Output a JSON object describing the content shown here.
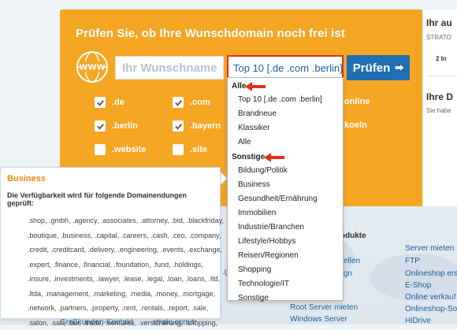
{
  "headline": "Prüfen Sie, ob Ihre Wunschdomain noch frei ist",
  "search": {
    "placeholder": "Ihr Wunschname",
    "value": ""
  },
  "tld_select": {
    "selected": "Top 10 [.de .com .berlin]"
  },
  "check_button": {
    "label": "Prüfen",
    "icon": "arrow-right-icon"
  },
  "checkboxes": [
    {
      "label": ".de",
      "checked": true
    },
    {
      "label": ".com",
      "checked": true
    },
    {
      "label": ".berlin",
      "checked": true
    },
    {
      "label": ".bayern",
      "checked": true
    },
    {
      "label": ".website",
      "checked": false
    },
    {
      "label": ".site",
      "checked": false
    }
  ],
  "hidden_labels": [
    ".online",
    ".koeln"
  ],
  "dropdown": {
    "groups": [
      {
        "label": "Alle",
        "items": [
          "Top 10 [.de .com .berlin]",
          "Brandneue",
          "Klassiker",
          "Alle"
        ]
      },
      {
        "label": "Sonstige",
        "items": [
          "Bildung/Politik",
          "Business",
          "Gesundheit/Ernährung",
          "Immobilien",
          "Industrie/Branchen",
          "Lifestyle/Hobbys",
          "Reisen/Regionen",
          "Shopping",
          "Technologie/IT",
          "Sonstige"
        ]
      }
    ]
  },
  "tooltip": {
    "title": "Business",
    "intro": "Die Verfügbarkeit wird für folgende Domainendungen geprüft:",
    "lines": [
      ".shop, .gmbh, .agency, .associates, .attorney, .bid, .blackfriday,",
      ".boutique, .business, .capital, .careers, .cash, .ceo, .company,",
      ".credit, .creditcard, .delivery, .engineering, .events, .exchange,",
      ".expert, .finance, .financial, .foundation, .fund, .holdings,",
      ".insure, .investments, .lawyer, .lease, .legal, .loan, .loans, .ltd,",
      ".ltda, .management, .marketing, .media, .money, .mortgage,",
      ".network, .partners, .property, .rent, .rentals, .report, .sale,",
      ".salon, .sarl, .tax, .trade, .ventures, .versicherung, .shopping,"
    ]
  },
  "right_panel": {
    "title": "Ihr au",
    "subtitle": "STRATO",
    "mid": "2 In",
    "title2": "Ihre D",
    "subtitle2": "Sie habe"
  },
  "footer": {
    "heading": "rodukte",
    "col_a": [
      "ellen",
      "gn",
      "Root Server mieten",
      "Windows Server"
    ],
    "col_b": [
      "Server mieten",
      "FTP",
      "Onlineshop ers",
      "E-Shop",
      "Online verkauf",
      "Onlineshop-So",
      "HiDrive"
    ],
    "frag_a": ".g",
    "frag_b": "Großkunden-Kontakt",
    "frag_c": "strato.com.tr"
  }
}
